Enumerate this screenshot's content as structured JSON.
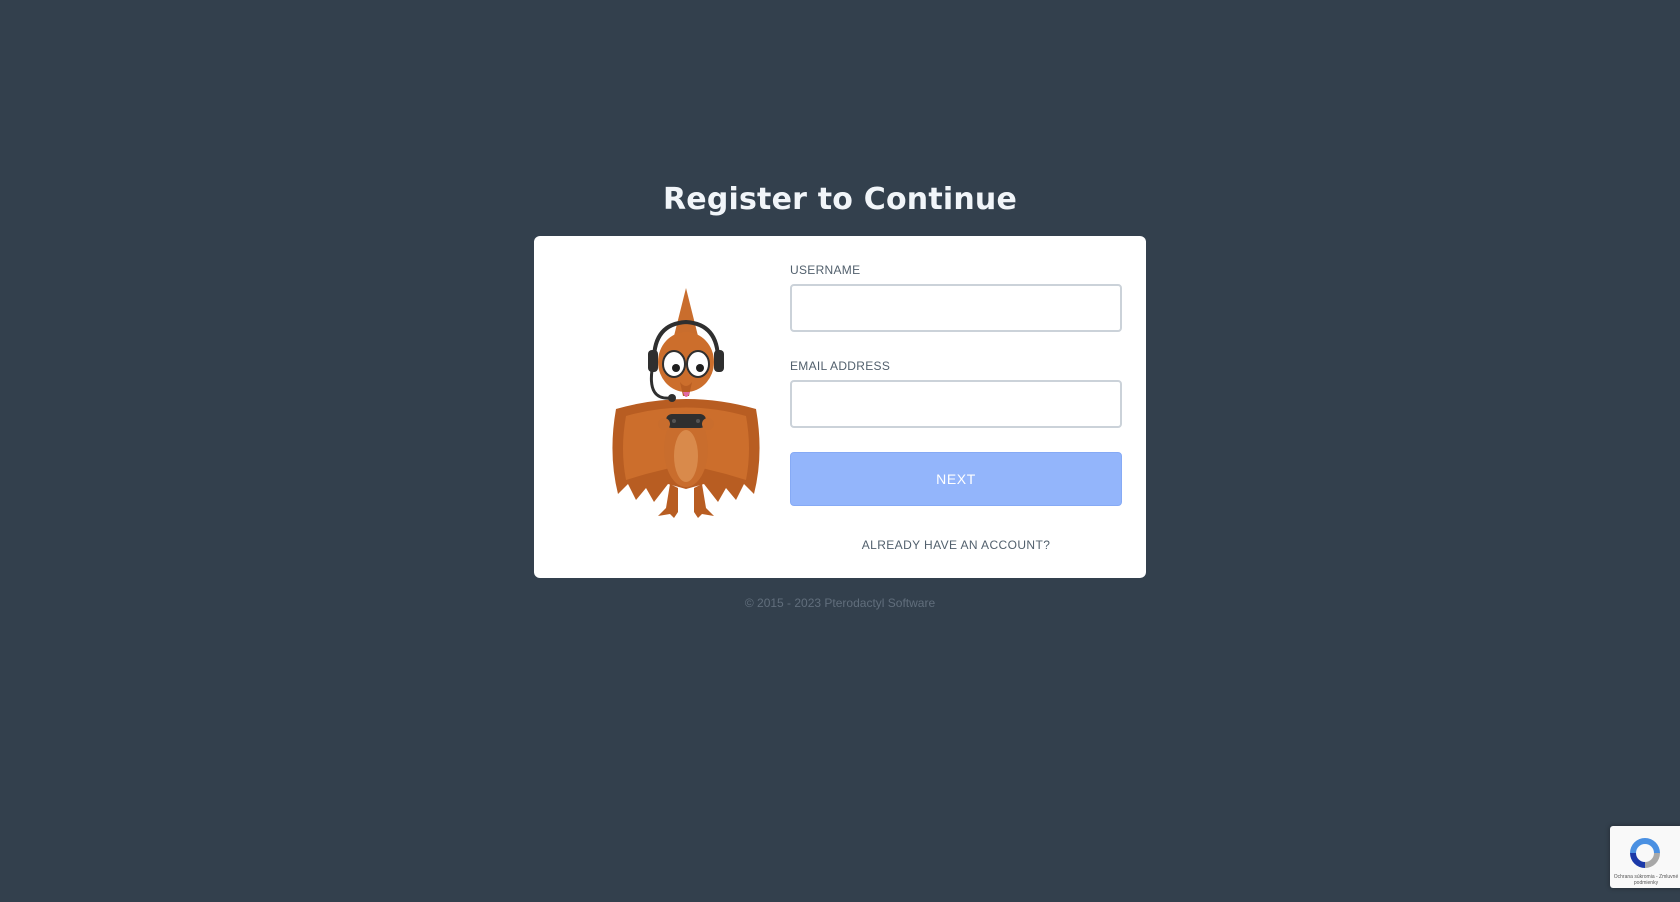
{
  "page": {
    "title": "Register to Continue"
  },
  "form": {
    "username_label": "USERNAME",
    "username_value": "",
    "email_label": "EMAIL ADDRESS",
    "email_value": "",
    "next_label": "NEXT",
    "account_link": "ALREADY HAVE AN ACCOUNT?"
  },
  "mascot": {
    "icon": "pterodactyl-gamer-mascot"
  },
  "footer": {
    "copyright": "© 2015 - 2023 Pterodactyl Software"
  },
  "recaptcha": {
    "icon": "recaptcha-icon",
    "legal_text": "Ochrana súkromia - Zmluvné podmienky"
  },
  "colors": {
    "background": "#33404d",
    "card": "#ffffff",
    "button": "#93b5fb",
    "mascot": "#c0692a"
  }
}
